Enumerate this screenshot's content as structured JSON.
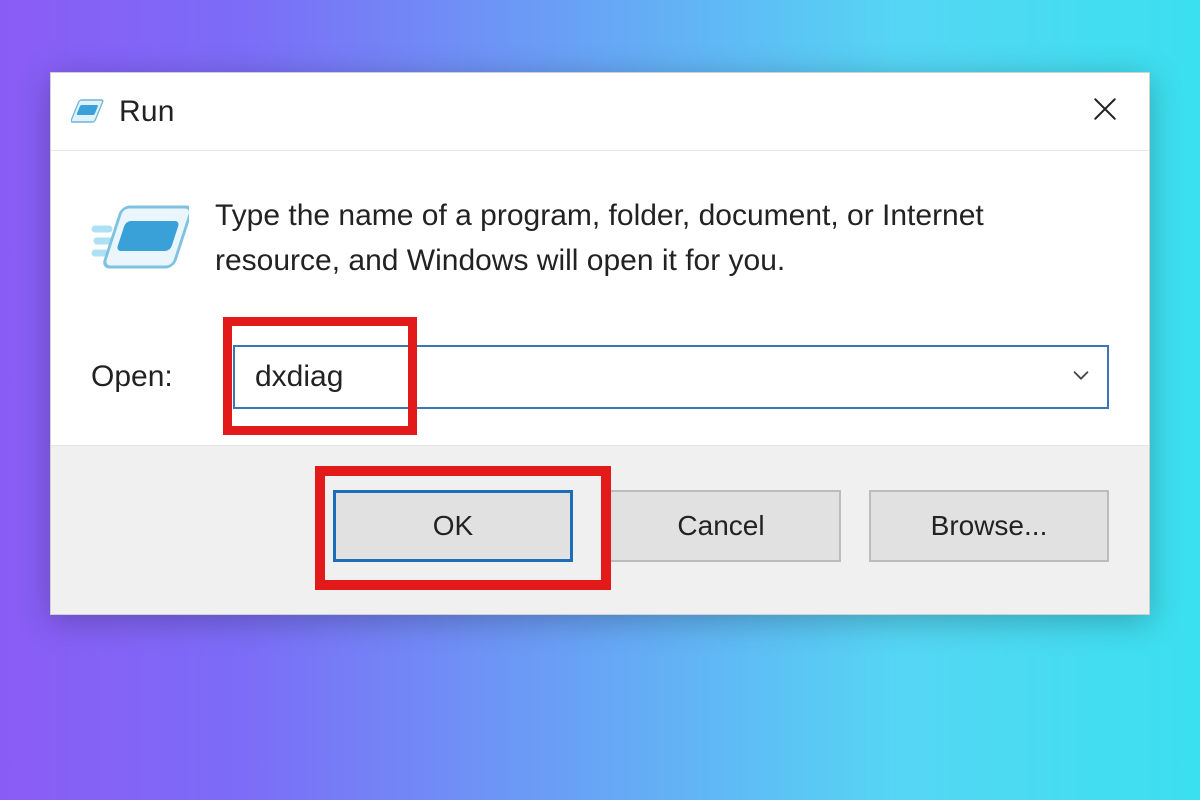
{
  "window": {
    "title": "Run",
    "icon": "run-icon",
    "close_icon": "close-icon"
  },
  "body": {
    "big_icon": "run-icon",
    "description": "Type the name of a program, folder, document, or Internet resource, and Windows will open it for you.",
    "open_label": "Open:",
    "open_value": "dxdiag",
    "dropdown_icon": "chevron-down-icon"
  },
  "footer": {
    "buttons": {
      "ok": "OK",
      "cancel": "Cancel",
      "browse": "Browse..."
    }
  },
  "colors": {
    "highlight": "#e21a1a",
    "field_border": "#3a78b5",
    "ok_border": "#1c6fb6"
  },
  "highlights": [
    "open-field-text",
    "ok-button"
  ]
}
